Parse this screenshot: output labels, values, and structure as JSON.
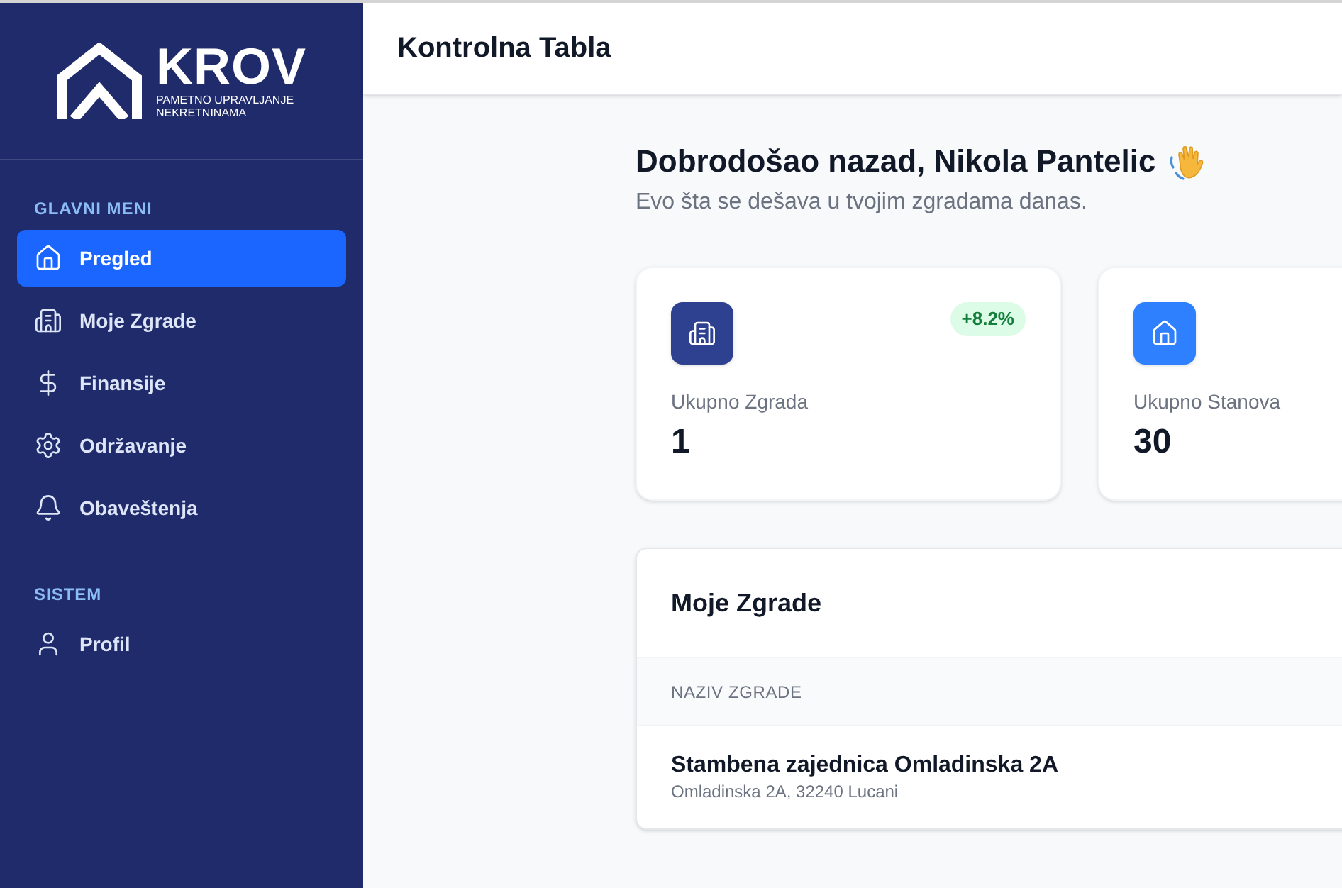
{
  "sidebar": {
    "logo": {
      "name": "KROV",
      "tagline": "PAMETNO UPRAVLJANJE NEKRETNINAMA"
    },
    "sections": [
      {
        "title": "GLAVNI MENI",
        "items": [
          {
            "label": "Pregled",
            "selected": true
          },
          {
            "label": "Moje Zgrade",
            "selected": false
          },
          {
            "label": "Finansije",
            "selected": false
          },
          {
            "label": "Održavanje",
            "selected": false
          },
          {
            "label": "Obaveštenja",
            "selected": false
          }
        ]
      },
      {
        "title": "SISTEM",
        "items": [
          {
            "label": "Profil",
            "selected": false
          }
        ]
      }
    ]
  },
  "header": {
    "title": "Kontrolna Tabla"
  },
  "welcome": {
    "title": "Dobrodošao nazad, Nikola Pantelic",
    "subtitle": "Evo šta se dešava u tvojim zgradama danas."
  },
  "stats": [
    {
      "label": "Ukupno Zgrada",
      "value": "1",
      "badge": "+8.2%",
      "color": "#2e4090"
    },
    {
      "label": "Ukupno Stanova",
      "value": "30",
      "color": "#2f80ff"
    }
  ],
  "buildings": {
    "title": "Moje Zgrade",
    "columns": [
      "NAZIV ZGRADE"
    ],
    "rows": [
      {
        "name": "Stambena zajednica Omladinska 2A",
        "address": "Omladinska 2A, 32240 Lucani"
      }
    ]
  }
}
